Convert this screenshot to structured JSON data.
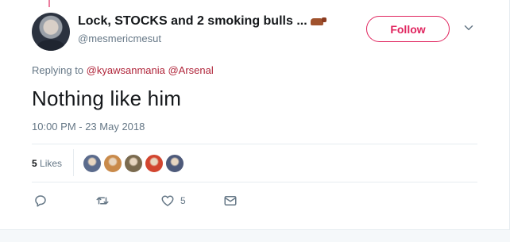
{
  "author": {
    "display_name": "Lock, STOCKS and 2 smoking bulls ...",
    "handle": "@mesmericmesut",
    "emoji_icon": "bull-emoji"
  },
  "follow_label": "Follow",
  "replying": {
    "prefix": "Replying to",
    "mentions": [
      "@kyawsanmania",
      "@Arsenal"
    ]
  },
  "tweet_text": "Nothing like him",
  "timestamp": "10:00 PM - 23 May 2018",
  "likes": {
    "count": "5",
    "label": "Likes",
    "liker_colors": [
      "#5b6b8c",
      "#c98a4a",
      "#7a6a4e",
      "#d2452f",
      "#4e5a7a"
    ]
  },
  "actions": {
    "reply_icon": "reply-icon",
    "retweet_icon": "retweet-icon",
    "like_icon": "heart-icon",
    "like_count": "5",
    "dm_icon": "envelope-icon"
  },
  "colors": {
    "accent": "#e0245e",
    "mention": "#b0253a",
    "secondary_text": "#657786"
  }
}
